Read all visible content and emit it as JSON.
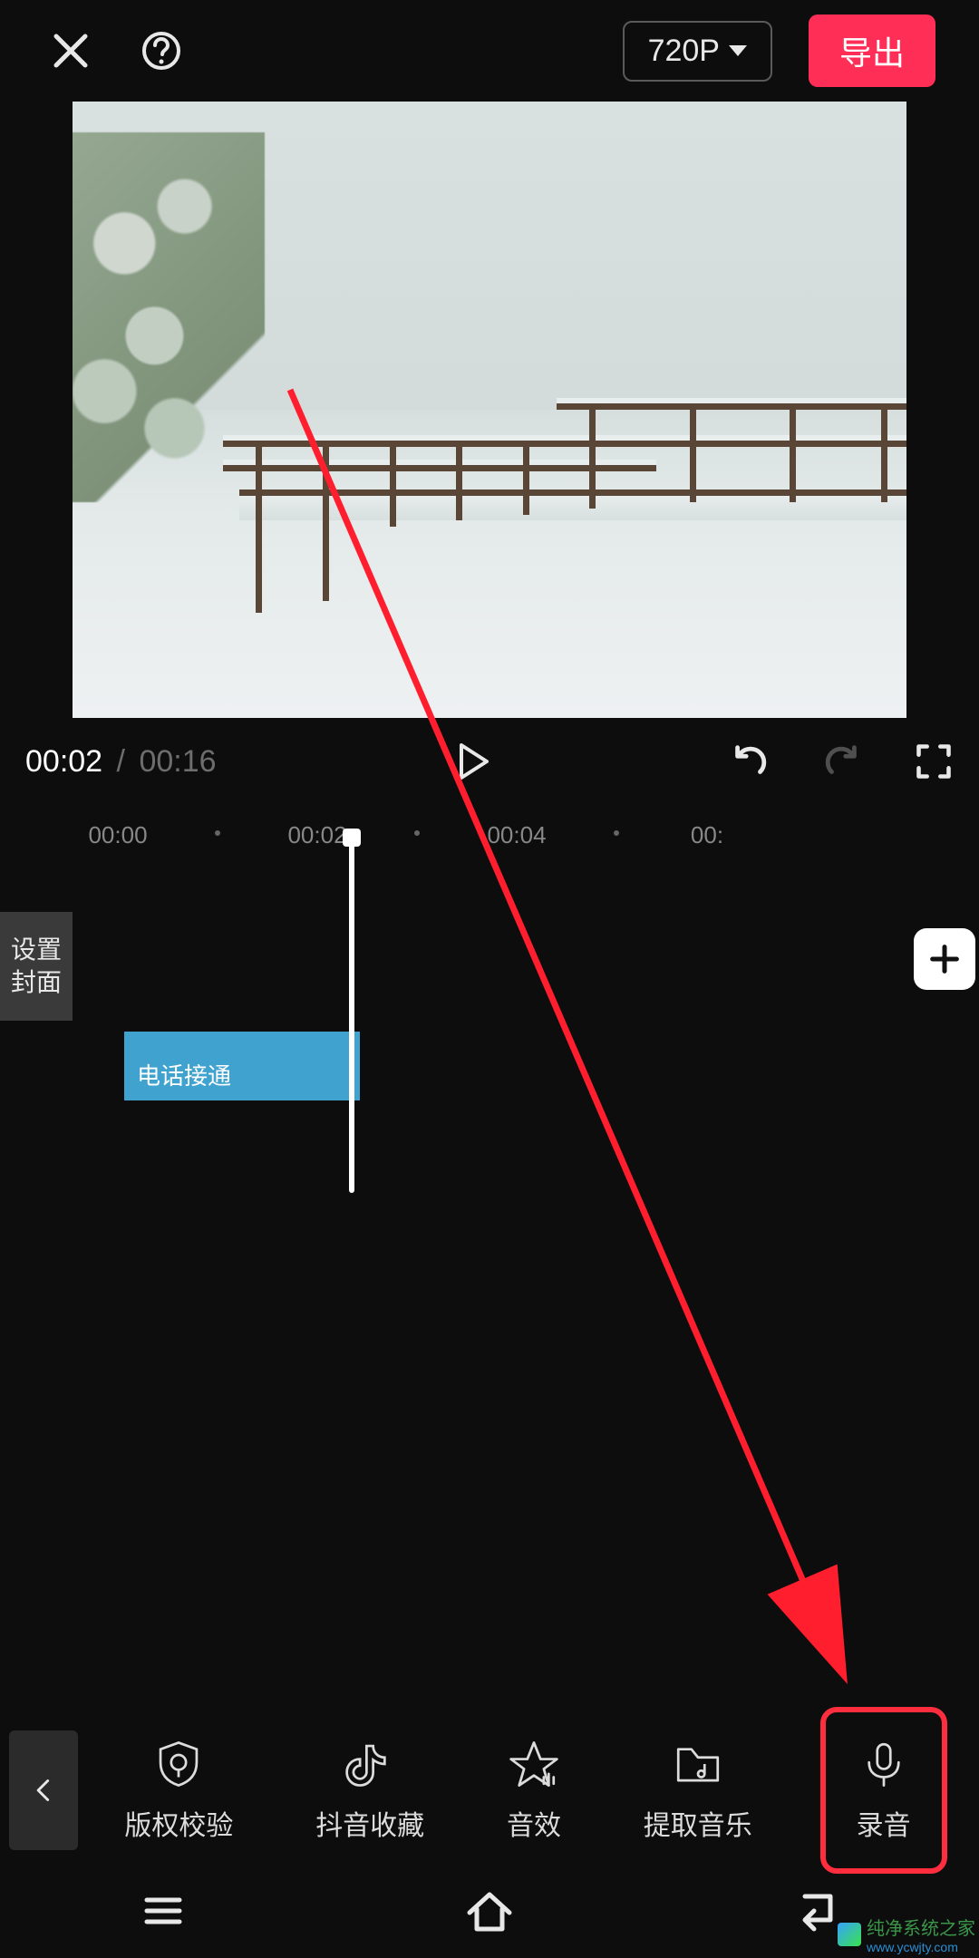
{
  "header": {
    "resolution_label": "720P",
    "export_label": "导出"
  },
  "playback": {
    "current": "00:02",
    "separator": "/",
    "total": "00:16"
  },
  "ruler": {
    "ticks": [
      "00:00",
      "00:02",
      "00:04",
      "00:"
    ]
  },
  "timeline": {
    "cover_label": "设置\n封面",
    "audio_clip_label": "电话接通"
  },
  "toolbar": {
    "items": [
      {
        "id": "copyright",
        "label": "版权校验"
      },
      {
        "id": "douyin-fav",
        "label": "抖音收藏"
      },
      {
        "id": "sound-fx",
        "label": "音效"
      },
      {
        "id": "extract",
        "label": "提取音乐"
      },
      {
        "id": "record",
        "label": "录音"
      }
    ]
  },
  "watermark": {
    "title": "纯净系统之家",
    "url": "www.ycwjty.com"
  },
  "colors": {
    "accent": "#ff2e57",
    "highlight_box": "#ff2e3f",
    "audio": "#3fa2cf"
  }
}
